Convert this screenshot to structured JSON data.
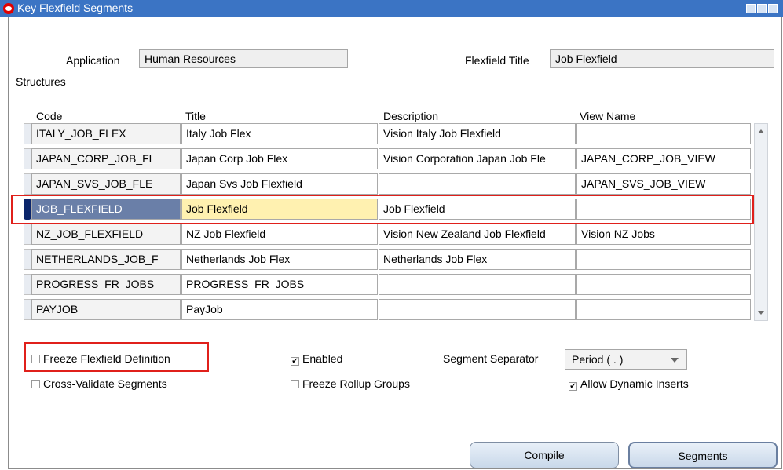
{
  "window": {
    "title": "Key Flexfield Segments"
  },
  "header": {
    "application_label": "Application",
    "application_value": "Human Resources",
    "flexfield_title_label": "Flexfield Title",
    "flexfield_title_value": "Job Flexfield"
  },
  "structures": {
    "section_label": "Structures",
    "columns": [
      "Code",
      "Title",
      "Description",
      "View Name"
    ],
    "rows": [
      {
        "code": "ITALY_JOB_FLEX",
        "title": "Italy Job Flex",
        "description": "Vision Italy Job Flexfield",
        "view": ""
      },
      {
        "code": "JAPAN_CORP_JOB_FL",
        "title": "Japan Corp Job Flex",
        "description": "Vision Corporation Japan Job Fle",
        "view": "JAPAN_CORP_JOB_VIEW"
      },
      {
        "code": "JAPAN_SVS_JOB_FLE",
        "title": "Japan Svs Job Flexfield",
        "description": "",
        "view": "JAPAN_SVS_JOB_VIEW"
      },
      {
        "code": "JOB_FLEXFIELD",
        "title": "Job Flexfield",
        "description": "Job Flexfield",
        "view": ""
      },
      {
        "code": "NZ_JOB_FLEXFIELD",
        "title": "NZ Job Flexfield",
        "description": "Vision New Zealand Job Flexfield",
        "view": "Vision NZ Jobs"
      },
      {
        "code": "NETHERLANDS_JOB_F",
        "title": "Netherlands Job Flex",
        "description": "Netherlands Job Flex",
        "view": ""
      },
      {
        "code": "PROGRESS_FR_JOBS",
        "title": "PROGRESS_FR_JOBS",
        "description": "",
        "view": ""
      },
      {
        "code": "PAYJOB",
        "title": "PayJob",
        "description": "",
        "view": ""
      }
    ]
  },
  "options": {
    "freeze_flexfield_definition": {
      "label": "Freeze Flexfield Definition",
      "checked": false
    },
    "cross_validate_segments": {
      "label": "Cross-Validate Segments",
      "checked": false
    },
    "enabled": {
      "label": "Enabled",
      "checked": true
    },
    "freeze_rollup_groups": {
      "label": "Freeze Rollup Groups",
      "checked": false
    },
    "segment_separator_label": "Segment Separator",
    "segment_separator_value": "Period ( . )",
    "allow_dynamic_inserts": {
      "label": "Allow Dynamic Inserts",
      "checked": true
    }
  },
  "buttons": {
    "compile": "Compile",
    "segments": "Segments"
  },
  "colors": {
    "titlebar": "#3b74c4",
    "highlight": "#e0201b",
    "selected_code": "#0a246a",
    "selected_title": "#fff1b0"
  }
}
